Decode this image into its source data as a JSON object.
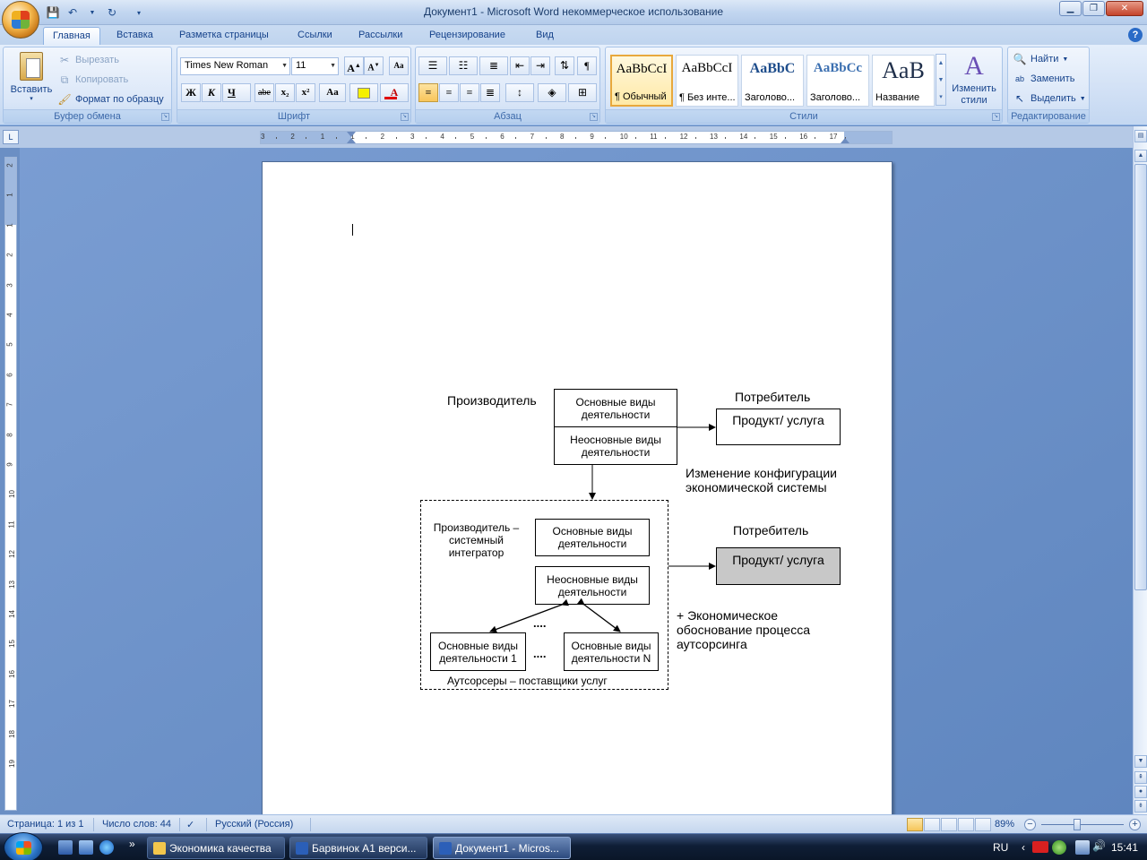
{
  "window": {
    "title": "Документ1 - Microsoft Word некоммерческое использование"
  },
  "tabs": [
    {
      "label": "Главная",
      "active": true
    },
    {
      "label": "Вставка"
    },
    {
      "label": "Разметка страницы"
    },
    {
      "label": "Ссылки"
    },
    {
      "label": "Рассылки"
    },
    {
      "label": "Рецензирование"
    },
    {
      "label": "Вид"
    }
  ],
  "clipboard": {
    "paste": "Вставить",
    "cut": "Вырезать",
    "copy": "Копировать",
    "format_painter": "Формат по образцу",
    "label": "Буфер обмена"
  },
  "font": {
    "name": "Times New Roman",
    "size": "11",
    "label": "Шрифт",
    "bold": "Ж",
    "italic": "К",
    "underline": "Ч",
    "strike": "abe",
    "sub": "x₂",
    "sup": "x²",
    "case": "Aa"
  },
  "paragraph": {
    "label": "Абзац"
  },
  "styles": {
    "label": "Стили",
    "items": [
      {
        "sample": "AaBbCcI",
        "name": "¶ Обычный"
      },
      {
        "sample": "AaBbCcI",
        "name": "¶ Без инте..."
      },
      {
        "sample": "AaBbC",
        "name": "Заголово..."
      },
      {
        "sample": "AaBbCc",
        "name": "Заголово..."
      },
      {
        "sample": "AaB",
        "name": "Название"
      }
    ],
    "change_styles": "Изменить стили"
  },
  "editing": {
    "label": "Редактирование",
    "find": "Найти",
    "replace": "Заменить",
    "select": "Выделить"
  },
  "ruler": {
    "h_ticks": [
      "3",
      "2",
      "1",
      "1",
      "2",
      "3",
      "4",
      "5",
      "6",
      "7",
      "8",
      "9",
      "10",
      "11",
      "12",
      "13",
      "14",
      "15",
      "16",
      "17"
    ],
    "v_ticks": [
      "2",
      "1",
      "1",
      "2",
      "3",
      "4",
      "5",
      "6",
      "7",
      "8",
      "9",
      "10",
      "11",
      "12",
      "13",
      "14",
      "15",
      "16",
      "17",
      "18",
      "19"
    ]
  },
  "diagram": {
    "producer": "Производитель",
    "consumer1": "Потребитель",
    "core1": "Основные виды деятельности",
    "noncore1": "Неосновные виды деятельности",
    "product1": "Продукт/ услуга",
    "change": "Изменение конфигурации экономической системы",
    "integrator": "Производитель – системный интегратор",
    "core2": "Основные виды деятельности",
    "noncore2": "Неосновные виды деятельности",
    "consumer2": "Потребитель",
    "product2": "Продукт/ услуга",
    "dots1": "....",
    "dots2": "....",
    "core_1": "Основные виды деятельности 1",
    "core_n": "Основные виды деятельности N",
    "outsourcers": "Аутсорсеры – поставщики услуг",
    "plus": "+ Экономическое обоснование процесса аутсорсинга"
  },
  "status": {
    "page": "Страница: 1 из 1",
    "words": "Число слов: 44",
    "language": "Русский (Россия)",
    "zoom": "89%"
  },
  "taskbar": {
    "items": [
      {
        "label": "Экономика качества"
      },
      {
        "label": "Барвинок А1 верси..."
      },
      {
        "label": "Документ1 - Micros...",
        "active": true
      }
    ],
    "lang": "RU",
    "time": "15:41"
  }
}
